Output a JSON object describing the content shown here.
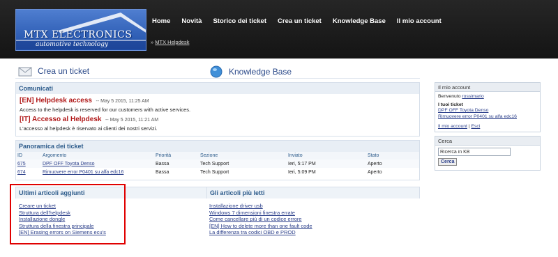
{
  "header": {
    "logo_title": "MTX ELECTRONICS",
    "logo_subtitle": "automotive technology",
    "nav": [
      "Home",
      "Novità",
      "Storico dei ticket",
      "Crea un ticket",
      "Knowledge Base",
      "Il mio account"
    ],
    "breadcrumb_prefix": "»",
    "breadcrumb_link": "MTX Helpdesk"
  },
  "actions": {
    "create_ticket": "Crea un ticket",
    "knowledge_base": "Knowledge Base",
    "create_icon": "envelope-icon",
    "kb_icon": "globe-icon"
  },
  "news": {
    "heading": "Comunicati",
    "items": [
      {
        "title": "[EN] Helpdesk access",
        "date": "-- May 5 2015, 11:25 AM",
        "body": "Access to the helpdesk is reserved for our customers with active services."
      },
      {
        "title": "[IT] Accesso al Helpdesk",
        "date": "-- May 5 2015, 11:21 AM",
        "body": "L'accesso al helpdesk è riservato ai clienti dei nostri servizi."
      }
    ]
  },
  "tickets": {
    "heading": "Panoramica dei ticket",
    "columns": [
      "ID",
      "Argomento",
      "Priorità",
      "Sezione",
      "Inviato",
      "Stato"
    ],
    "rows": [
      [
        "675",
        "DPF OFF Toyota Denso",
        "Bassa",
        "Tech Support",
        "Ieri, 5:17 PM",
        "Aperto"
      ],
      [
        "674",
        "Rimuovere error P0401 su alfa edc16",
        "Bassa",
        "Tech Support",
        "Ieri, 5:09 PM",
        "Aperto"
      ]
    ]
  },
  "latest_articles": {
    "heading": "Ultimi articoli aggiunti",
    "items": [
      "Creare un ticket",
      "Struttura dell'helpdesk",
      "Installazione dongle",
      "Struttura della finestra principale",
      "[EN] Erasing errors on Siemens ecu's"
    ]
  },
  "most_read": {
    "heading": "Gli articoli più letti",
    "items": [
      "Installazione driver usb",
      "Windows 7 dimensioni finestra errate",
      "Come cancellare più di un codice errore",
      "[EN] How to delete more than one fault code",
      "La differenza tra codici OBD e PROD"
    ]
  },
  "account": {
    "heading": "Il mio account",
    "welcome": "Benvenuto",
    "username": "rossimario",
    "your_tickets": "I tuoi ticket",
    "tickets": [
      "DPF OFF Toyota Denso",
      "Rimuovere error P0401 su alfa edc16"
    ],
    "my_account_link": "Il mio account",
    "separator": "|",
    "logout_link": "Esci"
  },
  "search": {
    "heading": "Cerca",
    "placeholder": "Ricerca in KB",
    "button": "Cerca"
  },
  "colors": {
    "accent": "#2b5a8a",
    "news_title": "#b01818",
    "highlight_frame": "#e00000"
  }
}
